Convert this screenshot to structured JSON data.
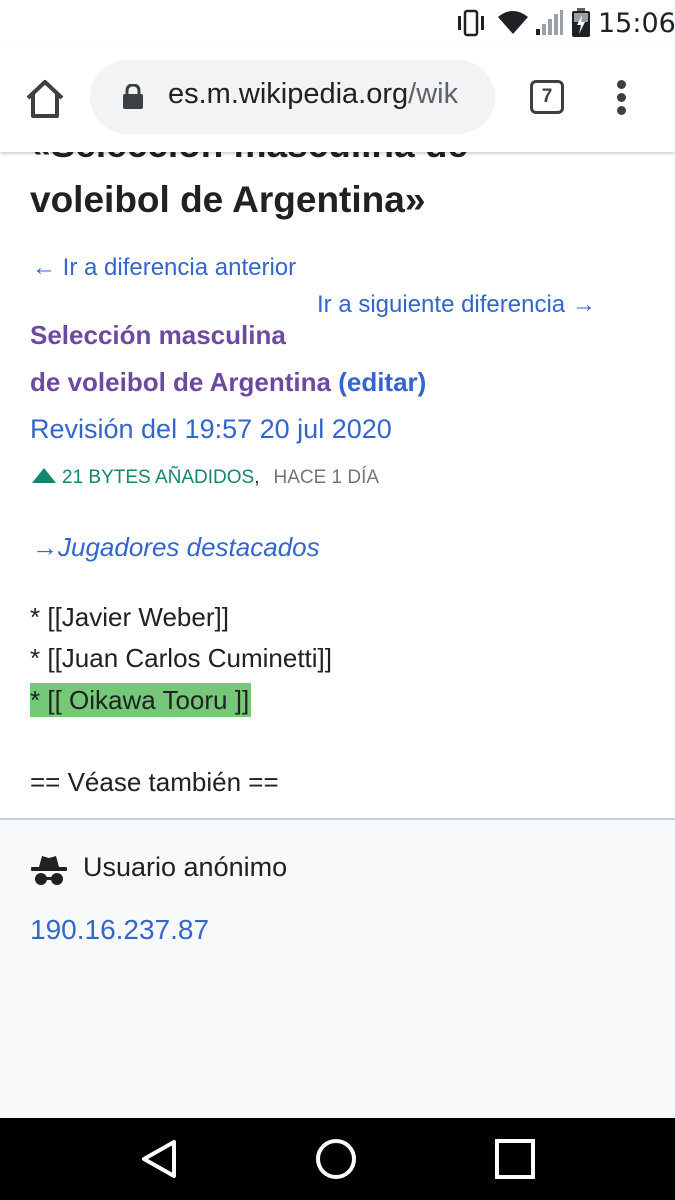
{
  "status_bar": {
    "time": "15:06",
    "icons": [
      "vibrate-icon",
      "wifi-icon",
      "cell-signal-icon",
      "battery-charging-icon"
    ]
  },
  "browser": {
    "url_host": "es.m.wikipedia.org",
    "url_path": "/wik",
    "tab_count": "7",
    "icons": [
      "home-icon",
      "lock-icon",
      "tab-switcher-icon",
      "more-menu-icon"
    ]
  },
  "diff": {
    "title_line1": "«Selección masculina de",
    "title_line2": "voleibol de Argentina»",
    "prev_diff": "← Ir a diferencia anterior",
    "next_diff": "Ir a siguiente diferencia →",
    "page_title_1": "Selección masculina",
    "page_title_2": "de voleibol de Argentina",
    "edit_link": "(editar)",
    "revision": "Revisión del 19:57 20 jul 2020",
    "bytes_added": "21 BYTES AÑADIDOS",
    "separator": ",",
    "time_ago": "HACE 1 DÍA",
    "section_comment": "→Jugadores destacados",
    "lines": [
      "* [[Javier Weber]]",
      "* [[Juan Carlos Cuminetti]]",
      "* [[ Oikawa Tooru ]]",
      "== Véase también =="
    ]
  },
  "user": {
    "label": "Usuario anónimo",
    "ip": "190.16.237.87"
  },
  "colors": {
    "link": "#3366cc",
    "visited": "#6b4ba1",
    "added_green": "#14866d",
    "added_highlight": "#75c877"
  },
  "navbar": {
    "icons": [
      "back-triangle-icon",
      "home-circle-icon",
      "recents-square-icon"
    ]
  }
}
